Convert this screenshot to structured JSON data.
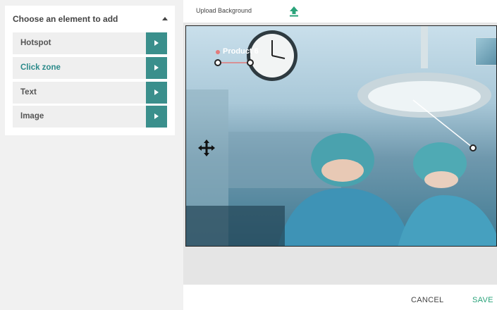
{
  "left_panel": {
    "header": "Choose an element to add",
    "items": [
      {
        "label": "Hotspot",
        "active": false
      },
      {
        "label": "Click zone",
        "active": true
      },
      {
        "label": "Text",
        "active": false
      },
      {
        "label": "Image",
        "active": false
      }
    ]
  },
  "toolbar": {
    "upload_label": "Upload Background",
    "upload_icon": "upload-icon"
  },
  "canvas": {
    "hotspot_label": "Product 6",
    "icons": [
      "move-icon",
      "drag-handle",
      "thumbnail-image"
    ]
  },
  "footer": {
    "cancel_label": "CANCEL",
    "save_label": "SAVE"
  },
  "colors": {
    "accent": "#3a8f8c",
    "active_text": "#2b8a8a",
    "save": "#2aa37a"
  }
}
